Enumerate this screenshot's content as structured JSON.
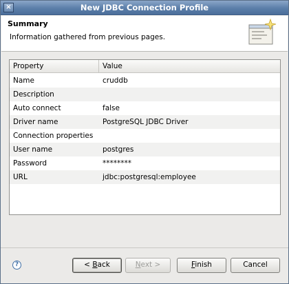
{
  "window": {
    "title": "New JDBC Connection Profile",
    "close_glyph": "×"
  },
  "banner": {
    "heading": "Summary",
    "description": "Information gathered from previous pages.",
    "image_icon": "wizard-banner-icon"
  },
  "table": {
    "columns": [
      "Property",
      "Value"
    ],
    "rows": [
      {
        "property": "Name",
        "value": "cruddb"
      },
      {
        "property": "Description",
        "value": ""
      },
      {
        "property": "Auto connect",
        "value": "false"
      },
      {
        "property": "Driver name",
        "value": "PostgreSQL JDBC Driver"
      },
      {
        "property": "Connection properties",
        "value": ""
      },
      {
        "property": "User name",
        "value": "postgres"
      },
      {
        "property": "Password",
        "value": "********"
      },
      {
        "property": "URL",
        "value": "jdbc:postgresql:employee"
      }
    ]
  },
  "buttons": {
    "help_glyph": "?",
    "back_mnemonic": "B",
    "back_rest": "ack",
    "back_prefix": "< ",
    "next_mnemonic": "N",
    "next_rest": "ext >",
    "finish_mnemonic": "F",
    "finish_rest": "inish",
    "cancel": "Cancel"
  }
}
